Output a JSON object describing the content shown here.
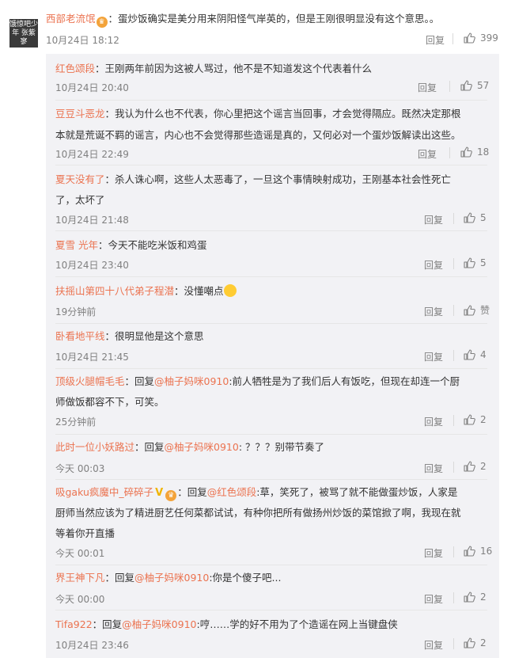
{
  "main_comment": {
    "avatar_text": "饿惊吧少年 张紫寥",
    "username": "西部老流氓",
    "badge": "",
    "text": "：蛋炒饭确实是美分用来阴阳怪气岸英的，但是王刚很明显没有这个意思。。",
    "time": "10月24日 18:12",
    "reply_label": "回复",
    "likes": "399"
  },
  "replies": [
    {
      "username": "红色颂段",
      "lines": [
        "：王刚两年前因为这被人骂过，他不是不知道发这个代表着什么"
      ],
      "time": "10月24日 20:40",
      "reply_label": "回复",
      "likes": "57"
    },
    {
      "username": "豆豆斗恶龙",
      "lines": [
        "：我认为什么也不代表，你心里把这个谣言当回事，才会觉得隔应。既然决定那根",
        "本就是荒诞不羁的谣言，内心也不会觉得那些造谣是真的，又何必对一个蛋炒饭解读出这些。"
      ],
      "time": "10月24日 22:49",
      "reply_label": "回复",
      "likes": "18"
    },
    {
      "username": "夏天没有了",
      "lines": [
        "：杀人诛心啊，这些人太恶毒了，一旦这个事情映射成功，王刚基本社会性死亡",
        "了，太坏了"
      ],
      "time": "10月24日 21:48",
      "reply_label": "回复",
      "likes": "5"
    },
    {
      "username": "夏雪 光年",
      "lines": [
        "：今天不能吃米饭和鸡蛋"
      ],
      "time": "10月24日 23:40",
      "reply_label": "回复",
      "likes": "5"
    },
    {
      "username": "扶摇山第四十八代弟子程潜",
      "lines": [
        "：没懂嘲点"
      ],
      "time": "19分钟前",
      "reply_label": "回复",
      "likes": "赞"
    },
    {
      "username": "卧看地平线",
      "lines": [
        "：很明显他是这个意思"
      ],
      "time": "10月24日 21:45",
      "reply_label": "回复",
      "likes": "4"
    },
    {
      "username": "顶级火腿帽毛毛",
      "lines": [
        "：回复",
        "@柚子妈咪0910",
        ":前人牺牲是为了我们后人有饭吃，但现在却连一个厨",
        "师做饭都容不下，可笑。"
      ],
      "time": "25分钟前",
      "reply_label": "回复",
      "likes": "2"
    },
    {
      "username": "此时一位小妖路过",
      "lines": [
        "：回复",
        "@柚子妈咪0910",
        ": ？？？别带节奏了"
      ],
      "time": "今天 00:03",
      "reply_label": "回复",
      "likes": "2"
    },
    {
      "username": "吸gaku疯魔中_碎碎子",
      "lines": [
        "：回复",
        "@红色颂段",
        ":草，笑死了，被骂了就不能做蛋炒饭，人家是",
        "厨师当然应该为了精进厨艺任何菜都试试，有种你把所有做扬州炒饭的菜馆掀了啊，我现在就",
        "等着你开直播"
      ],
      "time": "今天 00:01",
      "reply_label": "回复",
      "likes": "16"
    },
    {
      "username": "界王神下凡",
      "lines": [
        "：回复",
        "@柚子妈咪0910",
        ":你是个傻子吧..."
      ],
      "time": "今天 00:00",
      "reply_label": "回复",
      "likes": "2"
    },
    {
      "username": "Tifa922",
      "lines": [
        "：回复",
        "@柚子妈咪0910",
        ":哼……学的好不用为了个造谣在网上当键盘侠"
      ],
      "time": "10月24日 23:46",
      "reply_label": "回复",
      "likes": "2"
    }
  ],
  "colors": {
    "accent": "#eb7350",
    "panel": "#f2f2f5",
    "meta": "#808080"
  }
}
